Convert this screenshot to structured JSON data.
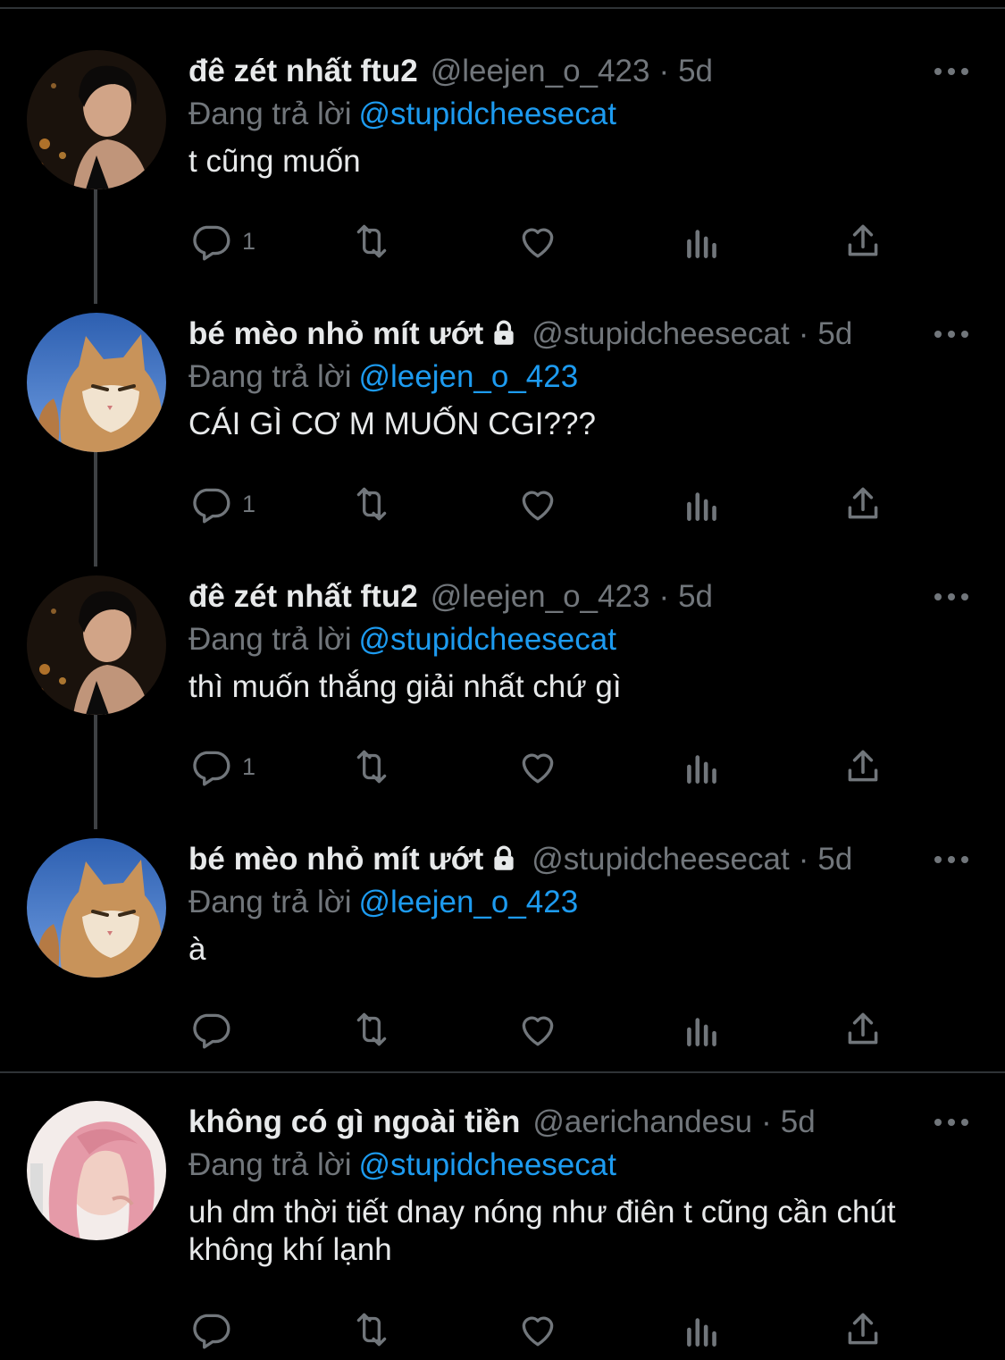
{
  "tweets": [
    {
      "name": "đê zét nhất ftu2",
      "handle": "@leejen_o_423",
      "time": "5d",
      "reply_prefix": "Đang trả lời",
      "reply_to": "@stupidcheesecat",
      "text": "t cũng muốn",
      "reply_count": "1",
      "locked": false,
      "avatar": "avatar-man"
    },
    {
      "name": "bé mèo nhỏ mít ướt",
      "handle": "@stupidcheesecat",
      "time": "5d",
      "reply_prefix": "Đang trả lời",
      "reply_to": "@leejen_o_423",
      "text": "CÁI GÌ CƠ M MUỐN CGI???",
      "reply_count": "1",
      "locked": true,
      "avatar": "avatar-cat"
    },
    {
      "name": "đê zét nhất ftu2",
      "handle": "@leejen_o_423",
      "time": "5d",
      "reply_prefix": "Đang trả lời",
      "reply_to": "@stupidcheesecat",
      "text": "thì muốn thắng giải nhất chứ gì",
      "reply_count": "1",
      "locked": false,
      "avatar": "avatar-man"
    },
    {
      "name": "bé mèo nhỏ mít ướt",
      "handle": "@stupidcheesecat",
      "time": "5d",
      "reply_prefix": "Đang trả lời",
      "reply_to": "@leejen_o_423",
      "text": "à",
      "reply_count": "",
      "locked": true,
      "avatar": "avatar-cat"
    },
    {
      "name": "không có gì ngoài tiền",
      "handle": "@aerichandesu",
      "time": "5d",
      "reply_prefix": "Đang trả lời",
      "reply_to": "@stupidcheesecat",
      "text": "uh dm thời tiết dnay nóng như điên t cũng cần chút không khí lạnh",
      "reply_count": "",
      "locked": false,
      "avatar": "avatar-girl"
    }
  ],
  "colors": {
    "background": "#000000",
    "text": "#e7e9ea",
    "secondary": "#71767b",
    "link": "#1d9bf0",
    "divider": "#2f3336"
  },
  "icons": [
    "reply-icon",
    "retweet-icon",
    "like-icon",
    "views-icon",
    "share-icon",
    "more-icon",
    "lock-icon"
  ]
}
